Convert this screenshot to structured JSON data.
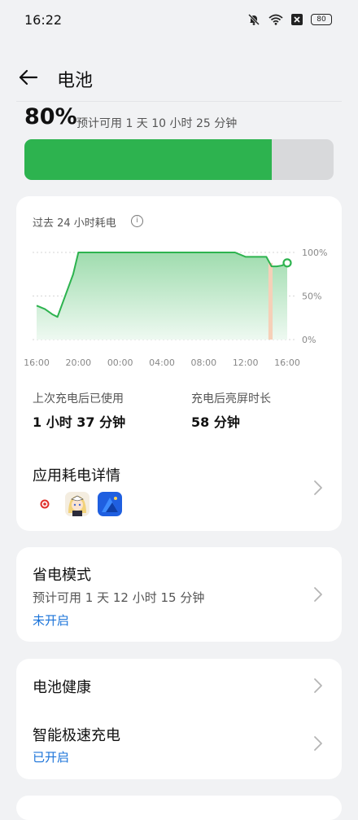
{
  "status_bar": {
    "time": "16:22",
    "battery_level": "80",
    "icons": [
      "mute-bell-icon",
      "wifi-icon",
      "close-box-icon",
      "battery-icon"
    ]
  },
  "header": {
    "title": "电池",
    "back_icon": "arrow-left-icon"
  },
  "battery": {
    "percent": "80%",
    "level": 0.8,
    "estimate": "预计可用 1 天 10 小时 25 分钟",
    "bar_color": "#2db34f"
  },
  "usage": {
    "title": "过去 24 小时耗电",
    "info_icon": "i",
    "last_charge_label": "上次充电后已使用",
    "last_charge_value": "1 小时 37 分钟",
    "screen_on_label": "充电后亮屏时长",
    "screen_on_value": "58 分钟",
    "app_details_title": "应用耗电详情",
    "app_icons": [
      "red-dot-app-icon",
      "anime-character-app-icon",
      "blue-mountain-app-icon"
    ]
  },
  "chart_data": {
    "type": "area",
    "x_ticks": [
      "16:00",
      "20:00",
      "00:00",
      "04:00",
      "08:00",
      "12:00",
      "16:00"
    ],
    "y_ticks": [
      "100%",
      "50%",
      "0%"
    ],
    "ylim": [
      0,
      100
    ],
    "grid": true,
    "series": [
      {
        "values_hours": [
          0,
          0.8,
          1.5,
          2,
          3.5,
          4,
          5,
          6,
          8,
          12,
          16,
          19,
          20,
          20.5,
          22,
          22.5,
          23,
          23.5,
          24
        ],
        "values": [
          39,
          35,
          29,
          26,
          75,
          100,
          100,
          100,
          100,
          100,
          100,
          100,
          95,
          95,
          95,
          84,
          84,
          85,
          88
        ]
      }
    ],
    "charging_segment_hours": [
      22.2,
      22.6
    ],
    "line_color": "#2db34f",
    "charging_color": "#f6d0b8"
  },
  "power_save": {
    "title": "省电模式",
    "estimate": "预计可用 1 天 12 小时 15 分钟",
    "status": "未开启"
  },
  "health": {
    "title": "电池健康"
  },
  "fast_charge": {
    "title": "智能极速充电",
    "status": "已开启"
  }
}
